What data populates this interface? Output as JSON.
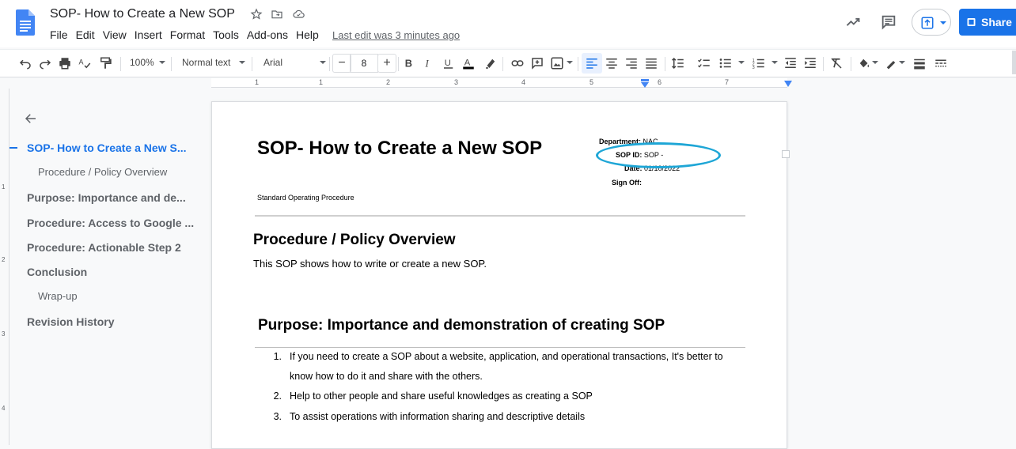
{
  "app": {
    "title": "SOP- How to Create a New SOP",
    "menus": [
      "File",
      "Edit",
      "View",
      "Insert",
      "Format",
      "Tools",
      "Add-ons",
      "Help"
    ],
    "last_edit": "Last edit was 3 minutes ago",
    "share_label": "Share",
    "accent_color": "#1a73e8"
  },
  "toolbar": {
    "zoom": "100%",
    "style": "Normal text",
    "font": "Arial",
    "font_size": "8",
    "minus": "−",
    "plus": "+"
  },
  "ruler": {
    "numbers": [
      "1",
      "1",
      "2",
      "3",
      "4",
      "5",
      "6",
      "7"
    ],
    "vnumbers": [
      "1",
      "2",
      "3",
      "4"
    ]
  },
  "outline": {
    "items": [
      {
        "label": "SOP- How to Create a New S...",
        "level": "h1",
        "active": true
      },
      {
        "label": "Procedure / Policy Overview",
        "level": "sub"
      },
      {
        "label": "Purpose: Importance and de...",
        "level": "h1"
      },
      {
        "label": "Procedure: Access to Google ...",
        "level": "h1"
      },
      {
        "label": "Procedure: Actionable Step 2",
        "level": "h1"
      },
      {
        "label": "Conclusion",
        "level": "h1"
      },
      {
        "label": "Wrap-up",
        "level": "sub"
      },
      {
        "label": "Revision History",
        "level": "h1"
      }
    ]
  },
  "document": {
    "title": "SOP- How to Create a New SOP",
    "subtitle": "Standard Operating Procedure",
    "meta": {
      "department_label": "Department:",
      "department_value": "NAC",
      "sop_id_label": "SOP ID:",
      "sop_id_value": "SOP -",
      "date_label": "Date:",
      "date_value": "01/10/2022",
      "signoff_label": "Sign Off:"
    },
    "section1": {
      "heading": "Procedure / Policy Overview",
      "text": "This SOP shows how to write or create a new SOP."
    },
    "section2": {
      "heading": "Purpose: Importance and demonstration of creating SOP",
      "items": [
        {
          "num": "1.",
          "line1": "If you need to create a SOP about a website, application, and operational transactions, It's better to",
          "line2": "know how to do it and share with the others."
        },
        {
          "num": "2.",
          "line1": "Help to other people and share useful knowledges as creating a SOP"
        },
        {
          "num": "3.",
          "line1": "To assist operations with information sharing and descriptive details"
        }
      ]
    }
  }
}
